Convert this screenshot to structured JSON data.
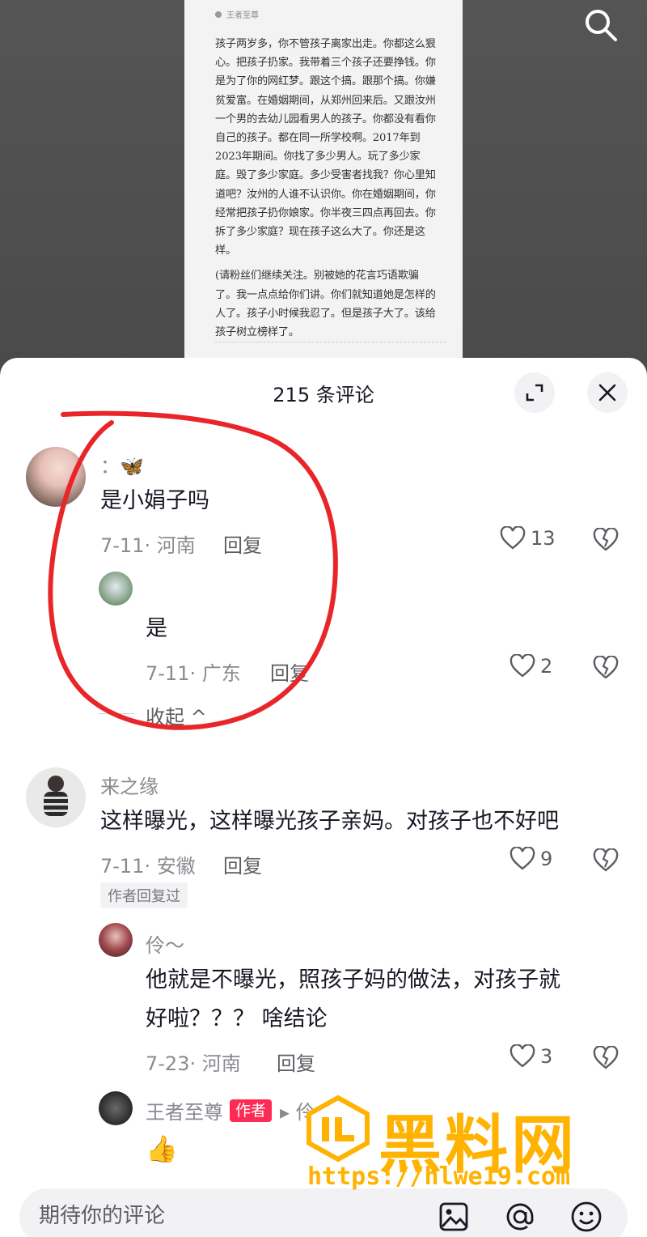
{
  "post_document": {
    "author": "王者至尊",
    "paragraphs": [
      "孩子两岁多，你不管孩子离家出走。你都这么狠心。把孩子扔家。我带着三个孩子还要挣钱。你是为了你的网红梦。跟这个搞。跟那个搞。你嫌贫爱富。在婚姻期间，从郑州回来后。又跟汝州一个男的去幼儿园看男人的孩子。你都没有看你自己的孩子。都在同一所学校啊。2017年到2023年期间。你找了多少男人。玩了多少家庭。毁了多少家庭。多少受害者找我？你心里知道吧？汝州的人谁不认识你。你在婚姻期间，你经常把孩子扔你娘家。你半夜三四点再回去。你拆了多少家庭？现在孩子这么大了。你还是这样。",
      "(请粉丝们继续关注。别被她的花言巧语欺骗了。我一点点给你们讲。你们就知道她是怎样的人了。孩子小时候我忍了。但是孩子大了。该给孩子树立榜样了。"
    ]
  },
  "icons": {
    "search": "search-icon",
    "expand": "expand-icon",
    "close": "close-icon",
    "like": "heart-icon",
    "dislike": "broken-heart-icon",
    "image": "image-icon",
    "mention": "at-icon",
    "emoji": "emoji-icon"
  },
  "colors": {
    "accent": "#fe2c55",
    "annotation": "#e8262a",
    "watermark": "#ffb300"
  },
  "panel": {
    "title": "215 条评论"
  },
  "comments": [
    {
      "name": "：🦋",
      "text": "是小娟子吗",
      "meta": "7-11· 河南",
      "reply": "回复",
      "likes": "13",
      "replies": [
        {
          "name": "",
          "text": "是",
          "meta": "7-11· 广东",
          "reply": "回复",
          "likes": "2"
        }
      ],
      "collapse": "收起 ^"
    },
    {
      "name": "来之缘",
      "text": "这样曝光，这样曝光孩子亲妈。对孩子也不好吧",
      "meta": "7-11· 安徽",
      "reply": "回复",
      "likes": "9",
      "tag": "作者回复过",
      "replies": [
        {
          "name": "伶～",
          "text_line1": "他就是不曝光，照孩子妈的做法，对孩子就",
          "text_line2": "好啦？？？ 啥结论",
          "meta": "7-23· 河南",
          "reply": "回复",
          "likes": "3"
        },
        {
          "name": "王者至尊",
          "badge": "作者",
          "reply_to": "▸ 伶",
          "text": "👍"
        }
      ]
    }
  ],
  "input": {
    "placeholder": "期待你的评论"
  },
  "watermark": {
    "title": "黑料网",
    "url": "https://hlwe19.com"
  }
}
